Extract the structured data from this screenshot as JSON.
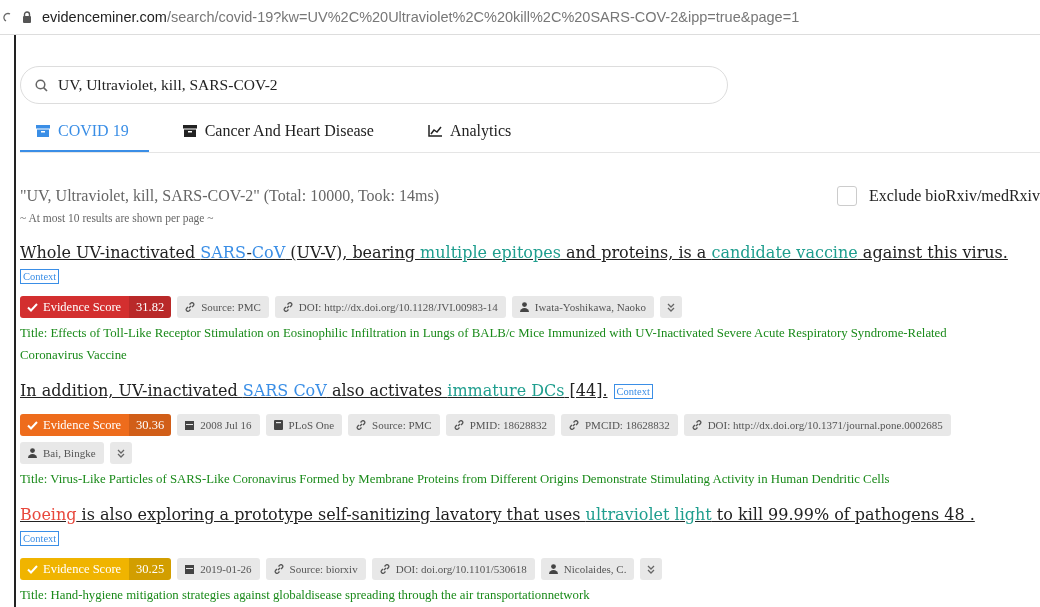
{
  "browser": {
    "url_domain": "evidenceminer.com",
    "url_path": "/search/covid-19?kw=UV%2C%20Ultraviolet%2C%20kill%2C%20SARS-COV-2&ipp=true&page=1"
  },
  "search": {
    "value": "UV, Ultraviolet, kill, SARS-COV-2"
  },
  "tabs": [
    {
      "label": "COVID 19",
      "kind": "archive",
      "selected": true
    },
    {
      "label": "Cancer And Heart Disease",
      "kind": "archive",
      "selected": false
    },
    {
      "label": "Analytics",
      "kind": "chart",
      "selected": false
    }
  ],
  "summary": {
    "query": "\"UV, Ultraviolet, kill, SARS-COV-2\" (Total: 10000, Took: 14ms)",
    "note": "~ At most 10 results are shown per page ~",
    "exclude_label": "Exclude bioRxiv/medRxiv",
    "exclude_checked": false
  },
  "results": [
    {
      "sentence": [
        {
          "text": "Whole UV-inactivated "
        },
        {
          "text": "SARS",
          "color": "#3a8ee6"
        },
        {
          "text": "-"
        },
        {
          "text": "CoV",
          "color": "#3a8ee6"
        },
        {
          "text": " (UV-V), bearing "
        },
        {
          "text": "multiple epitopes",
          "color": "#1f9e8e"
        },
        {
          "text": " and proteins, is a "
        },
        {
          "text": "candidate vaccine",
          "color": "#1f9e8e"
        },
        {
          "text": " against this virus."
        }
      ],
      "context": "Context",
      "score_label": "Evidence Score",
      "score": "31.82",
      "color": "#d32f2f",
      "tags": [
        {
          "kind": "source",
          "text": "Source: PMC"
        },
        {
          "kind": "link",
          "text": "DOI: http://dx.doi.org/10.1128/JVI.00983-14"
        },
        {
          "kind": "author",
          "text": "Iwata-Yoshikawa, Naoko"
        },
        {
          "kind": "expand"
        }
      ],
      "title": "Title: Effects of Toll-Like Receptor Stimulation on Eosinophilic Infiltration in Lungs of BALB/c Mice Immunized with UV-Inactivated Severe Acute Respiratory Syndrome-Related Coronavirus Vaccine"
    },
    {
      "sentence": [
        {
          "text": "In addition, UV-inactivated "
        },
        {
          "text": "SARS CoV",
          "color": "#3a8ee6"
        },
        {
          "text": " also activates "
        },
        {
          "text": "immature DCs",
          "color": "#1f9e8e"
        },
        {
          "text": " [44]."
        }
      ],
      "context": "Context",
      "score_label": "Evidence Score",
      "score": "30.36",
      "color": "#ee6c1c",
      "tags": [
        {
          "kind": "date",
          "text": "2008 Jul 16"
        },
        {
          "kind": "journal",
          "text": "PLoS One"
        },
        {
          "kind": "source",
          "text": "Source: PMC"
        },
        {
          "kind": "link",
          "text": "PMID: 18628832"
        },
        {
          "kind": "link",
          "text": "PMCID: 18628832"
        },
        {
          "kind": "link",
          "text": "DOI: http://dx.doi.org/10.1371/journal.pone.0002685"
        },
        {
          "kind": "author",
          "text": "Bai, Bingke"
        },
        {
          "kind": "expand"
        }
      ],
      "title": "Title: Virus-Like Particles of SARS-Like Coronavirus Formed by Membrane Proteins from Different Origins Demonstrate Stimulating Activity in Human Dendritic Cells"
    },
    {
      "sentence": [
        {
          "text": "Boeing",
          "color": "#e8483c"
        },
        {
          "text": " is also exploring a prototype self-sanitizing lavatory that uses "
        },
        {
          "text": "ultraviolet light",
          "color": "#1f9e8e"
        },
        {
          "text": " to kill 99.99% of pathogens 48 ."
        }
      ],
      "context": "Context",
      "score_label": "Evidence Score",
      "score": "30.25",
      "color": "#f0b400",
      "tags": [
        {
          "kind": "date",
          "text": "2019-01-26"
        },
        {
          "kind": "source",
          "text": "Source: biorxiv"
        },
        {
          "kind": "link",
          "text": "DOI: doi.org/10.1101/530618"
        },
        {
          "kind": "author",
          "text": "Nicolaides, C."
        },
        {
          "kind": "expand"
        }
      ],
      "title": "Title: Hand-hygiene mitigation strategies against globaldisease spreading through the air transportationnetwork"
    }
  ]
}
